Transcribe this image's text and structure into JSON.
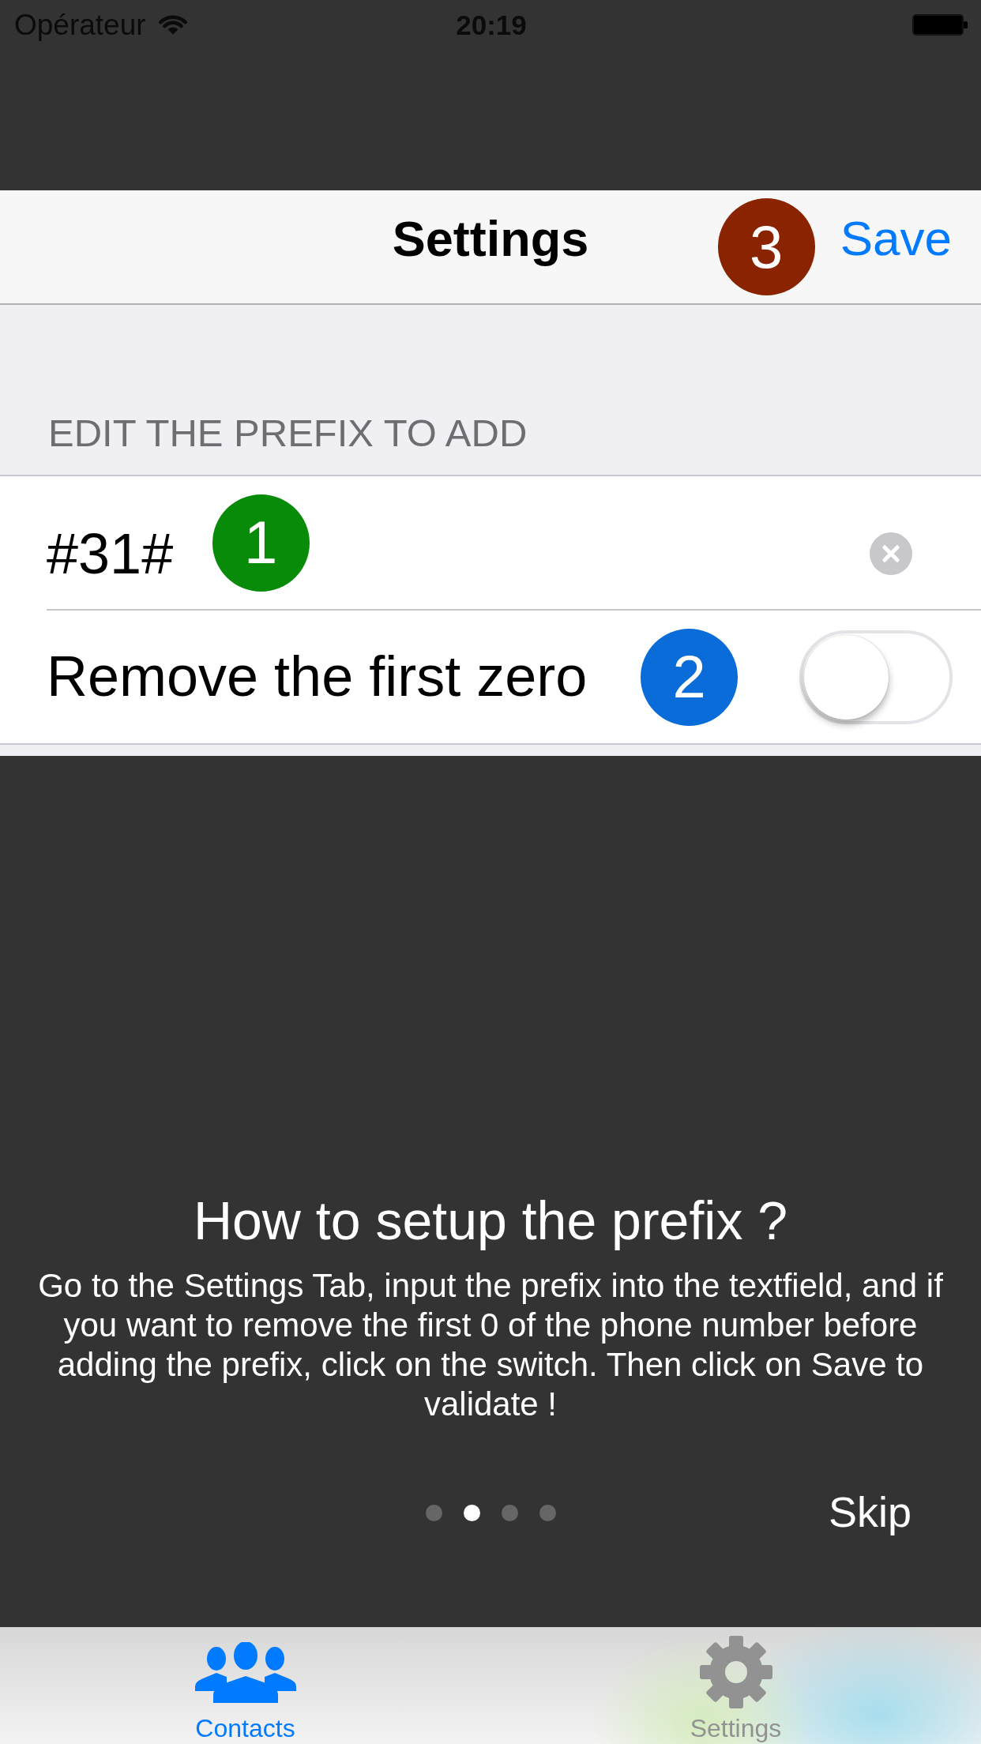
{
  "status_bar": {
    "carrier": "Opérateur",
    "time": "20:19"
  },
  "nav_bar": {
    "title": "Settings",
    "marker": {
      "label": "3",
      "color": "#8a2400"
    },
    "action": "Save"
  },
  "section": {
    "header": "EDIT THE PREFIX TO ADD",
    "rows": [
      {
        "kind": "text_field",
        "value": "#31#",
        "marker": {
          "label": "1",
          "color": "#088b08"
        }
      },
      {
        "kind": "switch",
        "label": "Remove the first zero",
        "marker": {
          "label": "2",
          "color": "#0a6cd8"
        },
        "on": false
      }
    ]
  },
  "tutorial": {
    "title": "How to setup the prefix ?",
    "text": "Go to the Settings Tab, input the prefix into the textfield, and if you want to remove the first 0 of the phone number before adding the prefix, click on the switch. Then click on Save to validate !",
    "pages": [
      {
        "selected": false
      },
      {
        "selected": true
      },
      {
        "selected": false
      },
      {
        "selected": false
      }
    ],
    "skip": "Skip"
  },
  "tab_bar": {
    "tabs": [
      {
        "label": "Contacts",
        "selected": true
      },
      {
        "label": "Settings",
        "selected": false
      }
    ]
  }
}
